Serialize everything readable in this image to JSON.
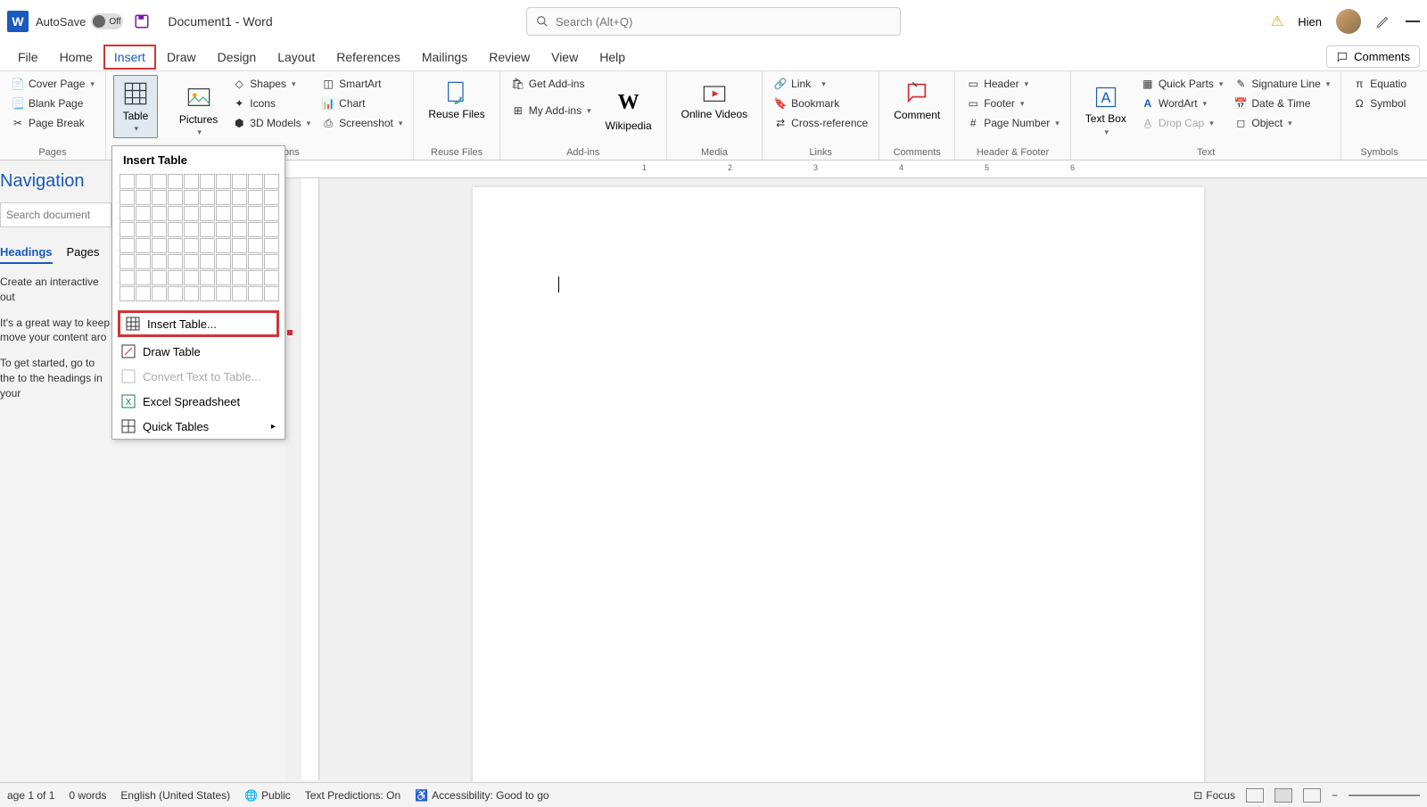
{
  "titlebar": {
    "autosave_label": "AutoSave",
    "autosave_state": "Off",
    "document_name": "Document1 - Word",
    "search_placeholder": "Search (Alt+Q)",
    "user_name": "Hien"
  },
  "tabs": [
    "File",
    "Home",
    "Insert",
    "Draw",
    "Design",
    "Layout",
    "References",
    "Mailings",
    "Review",
    "View",
    "Help"
  ],
  "active_tab": "Insert",
  "highlighted_tab": "Insert",
  "comments_label": "Comments",
  "ribbon": {
    "pages": {
      "title": "Pages",
      "cover_page": "Cover Page",
      "blank_page": "Blank Page",
      "page_break": "Page Break"
    },
    "tables": {
      "table": "Table"
    },
    "illustrations": {
      "title": "tions",
      "pictures": "Pictures",
      "shapes": "Shapes",
      "icons": "Icons",
      "models_3d": "3D Models",
      "smartart": "SmartArt",
      "chart": "Chart",
      "screenshot": "Screenshot"
    },
    "reuse": {
      "title": "Reuse Files",
      "reuse_files": "Reuse Files"
    },
    "addins": {
      "title": "Add-ins",
      "get_addins": "Get Add-ins",
      "my_addins": "My Add-ins",
      "wikipedia": "Wikipedia"
    },
    "media": {
      "title": "Media",
      "online_videos": "Online Videos"
    },
    "links": {
      "title": "Links",
      "link": "Link",
      "bookmark": "Bookmark",
      "cross_reference": "Cross-reference"
    },
    "comments": {
      "title": "Comments",
      "comment": "Comment"
    },
    "header_footer": {
      "title": "Header & Footer",
      "header": "Header",
      "footer": "Footer",
      "page_number": "Page Number"
    },
    "text": {
      "title": "Text",
      "text_box": "Text Box",
      "quick_parts": "Quick Parts",
      "wordart": "WordArt",
      "drop_cap": "Drop Cap",
      "signature_line": "Signature Line",
      "date_time": "Date & Time",
      "object": "Object"
    },
    "symbols": {
      "title": "Symbols",
      "equation": "Equatio",
      "symbol": "Symbol"
    }
  },
  "table_dropdown": {
    "title": "Insert Table",
    "insert_table": "Insert Table...",
    "draw_table": "Draw Table",
    "convert_text": "Convert Text to Table...",
    "excel_spreadsheet": "Excel Spreadsheet",
    "quick_tables": "Quick Tables"
  },
  "navigation": {
    "title": "Navigation",
    "search_placeholder": "Search document",
    "tabs": [
      "Headings",
      "Pages"
    ],
    "text1": "Create an interactive out",
    "text2": "It's a great way to keep move your content aro",
    "text3": "To get started, go to the to the headings in your"
  },
  "ruler_marks": [
    "1",
    "2",
    "3",
    "4",
    "5",
    "6"
  ],
  "statusbar": {
    "page": "age 1 of 1",
    "words": "0 words",
    "language": "English (United States)",
    "public": "Public",
    "predictions": "Text Predictions: On",
    "accessibility": "Accessibility: Good to go",
    "focus": "Focus"
  }
}
